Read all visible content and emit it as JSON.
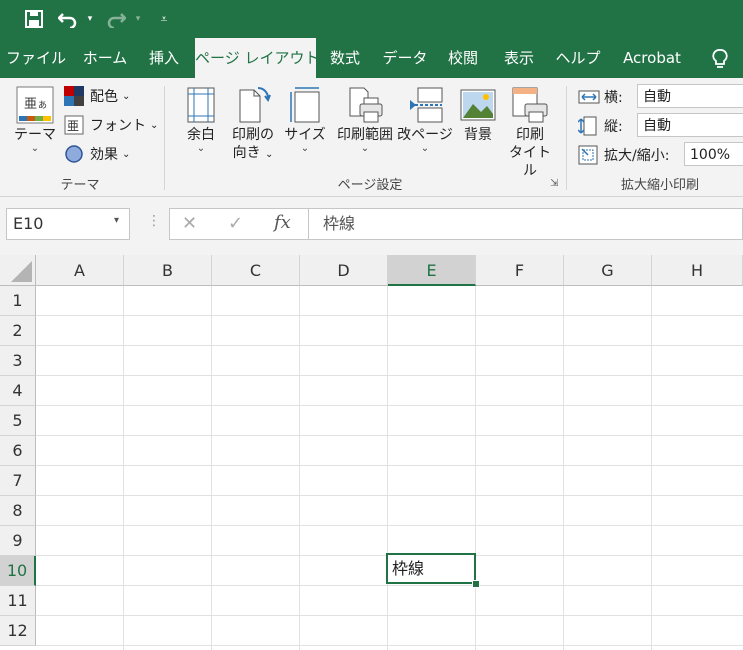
{
  "qat": {
    "save_icon": "save-icon",
    "undo_icon": "undo-icon",
    "redo_icon": "redo-icon",
    "customize_icon": "customize-qat-icon"
  },
  "tabs": [
    {
      "label": "ファイル"
    },
    {
      "label": "ホーム"
    },
    {
      "label": "挿入"
    },
    {
      "label": "ページ レイアウト"
    },
    {
      "label": "数式"
    },
    {
      "label": "データ"
    },
    {
      "label": "校閲"
    },
    {
      "label": "表示"
    },
    {
      "label": "ヘルプ"
    },
    {
      "label": "Acrobat"
    }
  ],
  "active_tab_index": 3,
  "tell_me_icon": "lightbulb-icon",
  "ribbon": {
    "theme_group": {
      "label": "テーマ",
      "themes_button": "テーマ",
      "colors_button": "配色",
      "fonts_button": "フォント",
      "effects_button": "効果"
    },
    "page_setup_group": {
      "label": "ページ設定",
      "margins": "余白",
      "orientation_line1": "印刷の",
      "orientation_line2": "向き",
      "size": "サイズ",
      "print_area": "印刷範囲",
      "breaks": "改ページ",
      "background": "背景",
      "print_titles_line1": "印刷",
      "print_titles_line2": "タイトル"
    },
    "scale_group": {
      "label": "拡大縮小印刷",
      "width_label": "横:",
      "width_value": "自動",
      "height_label": "縦:",
      "height_value": "自動",
      "scale_label": "拡大/縮小:",
      "scale_value": "100%"
    }
  },
  "formula_bar": {
    "name_box": "E10",
    "cancel_icon": "✕",
    "enter_icon": "✓",
    "fx_label": "fx",
    "formula": "枠線"
  },
  "grid": {
    "columns": [
      "A",
      "B",
      "C",
      "D",
      "E",
      "F",
      "G",
      "H"
    ],
    "rows": [
      "1",
      "2",
      "3",
      "4",
      "5",
      "6",
      "7",
      "8",
      "9",
      "10",
      "11",
      "12"
    ],
    "selected_column": "E",
    "selected_row": "10",
    "active_cell_value": "枠線"
  },
  "colors": {
    "accent": "#217346"
  }
}
